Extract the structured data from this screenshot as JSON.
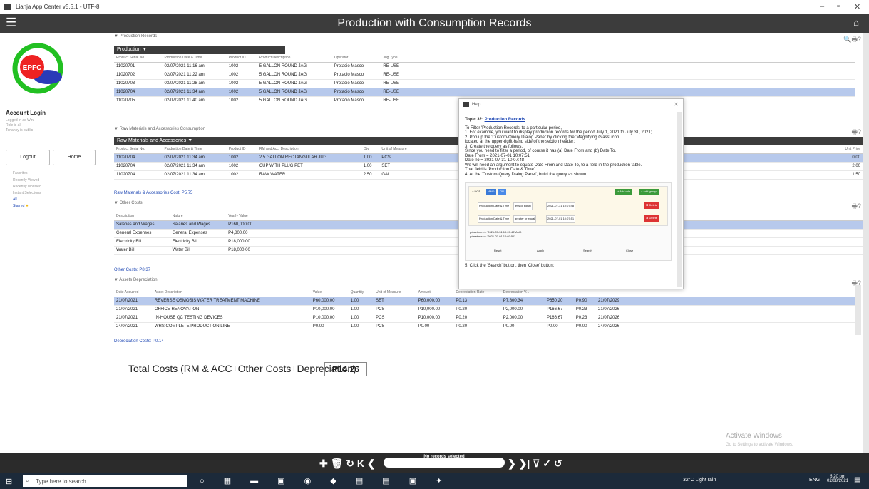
{
  "window": {
    "title": "Lianja App Center v5.5.1 - UTF-8",
    "min": "–",
    "max": "▫",
    "close": "✕"
  },
  "header": {
    "title": "Production with Consumption Records",
    "menu_icon": "☰",
    "home_icon": "⌂"
  },
  "sidebar": {
    "logo_text": "EPFC",
    "account_title": "Account Login",
    "lines": [
      "Logged in as Wiru",
      "Role is all",
      "Tenancy is public"
    ],
    "logout": "Logout",
    "home": "Home",
    "nav": [
      "Favorites",
      "Recently Viewed",
      "Recently Modified",
      "Instant Selections"
    ],
    "all": "All",
    "starred": "Starred"
  },
  "production": {
    "section": "Production Records",
    "bar": "Production",
    "headers": [
      "Product Serial No.",
      "Production Date & Time",
      "Product ID",
      "Product Description",
      "Operator",
      "Jug Type"
    ],
    "rows": [
      [
        "11020701",
        "02/07/2021 11:16 am",
        "1002",
        "5 GALLON ROUND JAG",
        "Protacio Masco",
        "RE-USE"
      ],
      [
        "11020702",
        "02/07/2021 11:22 am",
        "1002",
        "5 GALLON ROUND JAG",
        "Protacio Masco",
        "RE-USE"
      ],
      [
        "11020703",
        "03/07/2021 11:28 am",
        "1002",
        "5 GALLON ROUND JAG",
        "Protacio Masco",
        "RE-USE"
      ],
      [
        "11020704",
        "02/07/2021 11:34 am",
        "1002",
        "5 GALLON ROUND JAG",
        "Protacio Masco",
        "RE-USE"
      ],
      [
        "11020705",
        "02/07/2021 11:40 am",
        "1002",
        "5 GALLON ROUND JAG",
        "Protacio Masco",
        "RE-USE"
      ]
    ]
  },
  "rawmat": {
    "section": "Raw Materials and Accessories Consumption",
    "bar": "Raw Materials and Accessories",
    "headers": [
      "Product Serial No.",
      "Production Date & Time",
      "Product ID",
      "RM and Acc. Description",
      "Qty",
      "Unit of Measure"
    ],
    "unit_header": "Unit Price",
    "rows": [
      [
        "11020704",
        "02/07/2021 11:34 am",
        "1002",
        "2.5 GALLON RECTANGULAR JUG",
        "1.00",
        "PCS"
      ],
      [
        "11020704",
        "02/07/2021 11:34 am",
        "1002",
        "CUP WITH PLUG PET",
        "1.00",
        "SET"
      ],
      [
        "11020704",
        "02/07/2021 11:34 am",
        "1002",
        "RAW WATER",
        "2.50",
        "GAL"
      ]
    ],
    "unit_prices": [
      "0.00",
      "2.00",
      "1.50"
    ],
    "cost_label": "Raw Materials & Accessories Cost: P5.75"
  },
  "othercosts": {
    "section": "Other Costs",
    "headers": [
      "Description",
      "Nature",
      "Yearly Value"
    ],
    "rows": [
      [
        "Salaries and Wages",
        "Salaries and Wages",
        "P160,000.00"
      ],
      [
        "General Expenses",
        "General Expenses",
        "P4,800.00"
      ],
      [
        "Electricity Bill",
        "Electricity Bill",
        "P18,000.00"
      ],
      [
        "Water Bill",
        "Water Bill",
        "P18,000.00"
      ]
    ],
    "cost_label": "Other Costs: P8.37"
  },
  "assets": {
    "section": "Assets Depreciation",
    "headers": [
      "Date Acquired",
      "Asset Description",
      "Value",
      "Quantity",
      "Unit of Measure",
      "Amount",
      "Depreciation Rate",
      "Depreciation V..."
    ],
    "rows": [
      [
        "21/07/2021",
        "REVERSE OSMOSIS WATER TREATMENT MACHINE",
        "P60,000.00",
        "1.00",
        "SET",
        "P60,000.00",
        "P0.13",
        "P7,800.34",
        "P650.20",
        "P0.90",
        "21/07/2029"
      ],
      [
        "21/07/2021",
        "OFFICE RENOVATION",
        "P10,000.00",
        "1.00",
        "PCS",
        "P10,000.00",
        "P0.20",
        "P2,000.00",
        "P166.67",
        "P0.23",
        "21/07/2026"
      ],
      [
        "21/07/2021",
        "IN-HOUSE QC TESTING DEVICES",
        "P10,000.00",
        "1.00",
        "PCS",
        "P10,000.00",
        "P0.20",
        "P2,000.00",
        "P166.67",
        "P0.23",
        "21/07/2026"
      ],
      [
        "24/07/2021",
        "WRS COMPLETE PRODUCTION LINE",
        "P0.00",
        "1.00",
        "PCS",
        "P0.00",
        "P0.20",
        "P0.00",
        "P0.00",
        "P0.00",
        "24/07/2026"
      ]
    ],
    "cost_label": "Depreciation Costs: P0.14"
  },
  "total": {
    "label": "Total Costs (RM & ACC+Other Costs+Depreciation)",
    "value": "P14.26"
  },
  "help": {
    "title": "Help",
    "topic_prefix": "Topic 32: ",
    "topic": "Production Records",
    "lines": [
      "To Filter 'Production Records' to a particular period,",
      "1. For example, you want to display production records for the period July 1, 2021 to July 31, 2021;",
      "2. Pop up the 'Custom-Query Dialog Panel' by clicking the 'Magnifying Glass' icon",
      "located at the upper-right-hand side of the section header;",
      "3. Create the query as follows,",
      "Since you need to filter a period, of course it has (a) Date From and (b) Date To.",
      "Date From = 2021-07-01 10:07:51",
      "Date To = 2021-07-31 10:07:48",
      "We will need an argument to equate Date From and Date To, to a field in the production table.",
      "That field is 'Production Date & Time'",
      "4. At the 'Custom-Query Dialog Panel', build the query as shown,"
    ],
    "qb": {
      "not": "NOT",
      "and": "AND",
      "or": "OR",
      "add_rule": "+ Add rule",
      "add_group": "+ Add group",
      "field1": "Production Date & Time",
      "op1": "less or equal",
      "val1": "2021-07-31 10:07:48",
      "field2": "Production Date & Time",
      "op2": "greater or equal",
      "val2": "2021-07-01 10:07:51",
      "delete": "✖ Delete",
      "q1": "pdatetime <= '2021-07-31 10:07:48' AND",
      "q2": "pdatetime >= '2021-07-01 10:07:51'",
      "reset": "Reset",
      "apply": "Apply",
      "search": "Search",
      "close": "Close"
    },
    "footer": "5. Click the 'Search' button, then 'Close' button;"
  },
  "toolbar": {
    "status": "No records selected",
    "left": "✚ 🗑 ↻ K ❮",
    "right": "❯ ❯| ⊽ ✓ ↺"
  },
  "activate": {
    "line1": "Activate Windows",
    "line2": "Go to Settings to activate Windows."
  },
  "taskbar": {
    "search": "Type here to search",
    "weather": "32°C Light rain",
    "lang": "ENG",
    "time": "5:20 pm",
    "date": "02/08/2021"
  }
}
